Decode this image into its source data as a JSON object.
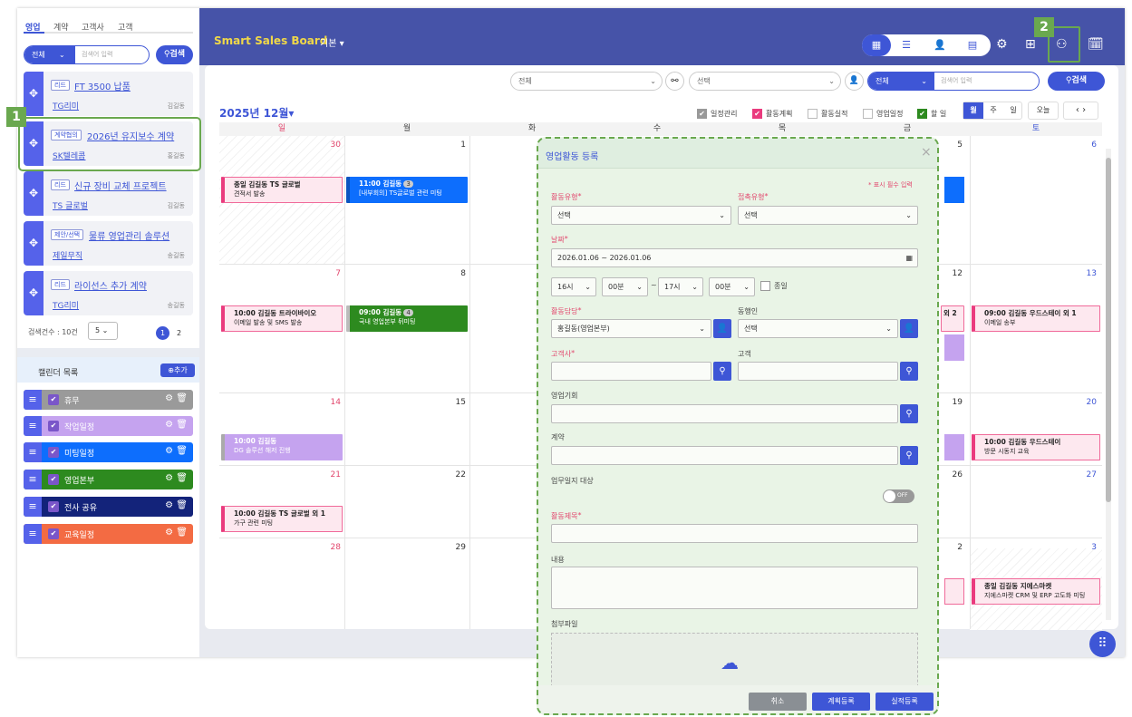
{
  "sidebar": {
    "tabs": [
      "영업",
      "계약",
      "고객사",
      "고객"
    ],
    "filter": "전체",
    "search_placeholder": "검색어 입력",
    "search_btn": "검색",
    "leads": [
      {
        "tag": "리드",
        "title": "FT 3500 납품",
        "company": "TG리미",
        "owner": "김길동"
      },
      {
        "tag": "계약협의",
        "title": "2026년 유지보수 계약",
        "company": "SK텔레콤",
        "owner": "홍길동"
      },
      {
        "tag": "리드",
        "title": "신규 장비 교체 프로젝트",
        "company": "TS 글로벌",
        "owner": "김길동"
      },
      {
        "tag": "제안/선택",
        "title": "물류 영업관리 솔루션",
        "company": "제일무직",
        "owner": "송길동"
      },
      {
        "tag": "리드",
        "title": "라이선스 추가 계약",
        "company": "TG리미",
        "owner": "송길동"
      }
    ],
    "count": "검색건수 : 10건",
    "page_size": "5",
    "pages": [
      "1",
      "2"
    ],
    "calendar_title": "캘린더 목록",
    "add_btn": "추가",
    "calendars": [
      {
        "name": "휴무",
        "color": "#9a9a9a"
      },
      {
        "name": "작업일정",
        "color": "#c5a3ef"
      },
      {
        "name": "미팅일정",
        "color": "#0d6efd"
      },
      {
        "name": "영업본부",
        "color": "#2d8a1f"
      },
      {
        "name": "전사 공유",
        "color": "#13237a"
      },
      {
        "name": "교육일정",
        "color": "#f36b43"
      }
    ]
  },
  "header": {
    "brand": "Smart Sales Board",
    "mode": "기본"
  },
  "toolbar": {
    "org_select": "전체",
    "user_select": "선택",
    "scope": "전체",
    "search_placeholder": "검색어 입력",
    "search_btn": "검색"
  },
  "calendar": {
    "month": "2025년 12월",
    "filters": [
      {
        "label": "일정관리",
        "checked": true,
        "color": "#999"
      },
      {
        "label": "활동계획",
        "checked": true,
        "color": "#ea3b7e"
      },
      {
        "label": "활동실적",
        "checked": false
      },
      {
        "label": "영업일정",
        "checked": false
      },
      {
        "label": "할 일",
        "checked": true,
        "color": "#2d8a1f"
      }
    ],
    "views": [
      "월",
      "주",
      "일"
    ],
    "today": "오늘",
    "weekdays": [
      "일",
      "월",
      "화",
      "수",
      "목",
      "금",
      "토"
    ],
    "dates": [
      [
        "30",
        "1",
        "",
        "",
        "",
        "",
        "5",
        "6"
      ],
      [
        "7",
        "8",
        "",
        "",
        "",
        "12",
        "13"
      ],
      [
        "14",
        "15",
        "",
        "",
        "",
        "19",
        "20"
      ],
      [
        "21",
        "22",
        "",
        "",
        "",
        "26",
        "27"
      ],
      [
        "28",
        "29",
        "",
        "",
        "",
        "2",
        "3"
      ]
    ],
    "events": {
      "e1": {
        "time": "종일 김길동  TS 글로벌",
        "desc": "견적서 발송"
      },
      "e2": {
        "time": "11:00 김길동",
        "badge": "3",
        "desc": "[내부회의] TS글로벌 관련 미팅"
      },
      "e3": {
        "time": "10:00 김길동  트라이바이오",
        "desc": "이메일 발송 및 SMS 발송"
      },
      "e4": {
        "time": "09:00 김길동",
        "badge": "4",
        "desc": "국내 영업본부 뒤미팅"
      },
      "e5": {
        "time": "09:00 김길동  우드스테이 외 1",
        "desc": "이메일 송부"
      },
      "e6": {
        "time": "10:00 김길동",
        "desc": "DG 솔루션 해저 진행"
      },
      "e7": {
        "time": "10:00 김길동  우드스테이",
        "desc": "방문 시동지 교육"
      },
      "e8": {
        "time": "10:00 김길동  TS 글로벌 외 1",
        "desc": "가구 관련 미팅"
      },
      "e9": {
        "time": "종일 김길동  지에스마켓",
        "desc": "지에스마켓 CRM 및 ERP 고도화 미팅"
      },
      "e10": {
        "time": "외 2"
      }
    }
  },
  "modal": {
    "title": "영업활동 등록",
    "required_note": "표시 필수 입력",
    "activity_type_label": "활동유형",
    "activity_type": "선택",
    "contact_type_label": "접촉유형",
    "contact_type": "선택",
    "date_label": "날짜",
    "date_value": "2026.01.06 ~ 2026.01.06",
    "hour_from": "16시",
    "min_from": "00분",
    "tilde": "~",
    "hour_to": "17시",
    "min_to": "00분",
    "allday": "종일",
    "owner_label": "활동담당",
    "owner_value": "홍길동(영업본부)",
    "companion_label": "동행인",
    "companion_value": "선택",
    "client_company_label": "고객사",
    "client_label": "고객",
    "opportunity_label": "영업기회",
    "contract_label": "계약",
    "journal_label": "업무일지 대상",
    "toggle": "OFF",
    "subject_label": "활동제목",
    "content_label": "내용",
    "attach_label": "첨부파일",
    "cancel_btn": "취소",
    "plan_btn": "계획등록",
    "result_btn": "실적등록"
  },
  "callouts": [
    "1",
    "2"
  ]
}
